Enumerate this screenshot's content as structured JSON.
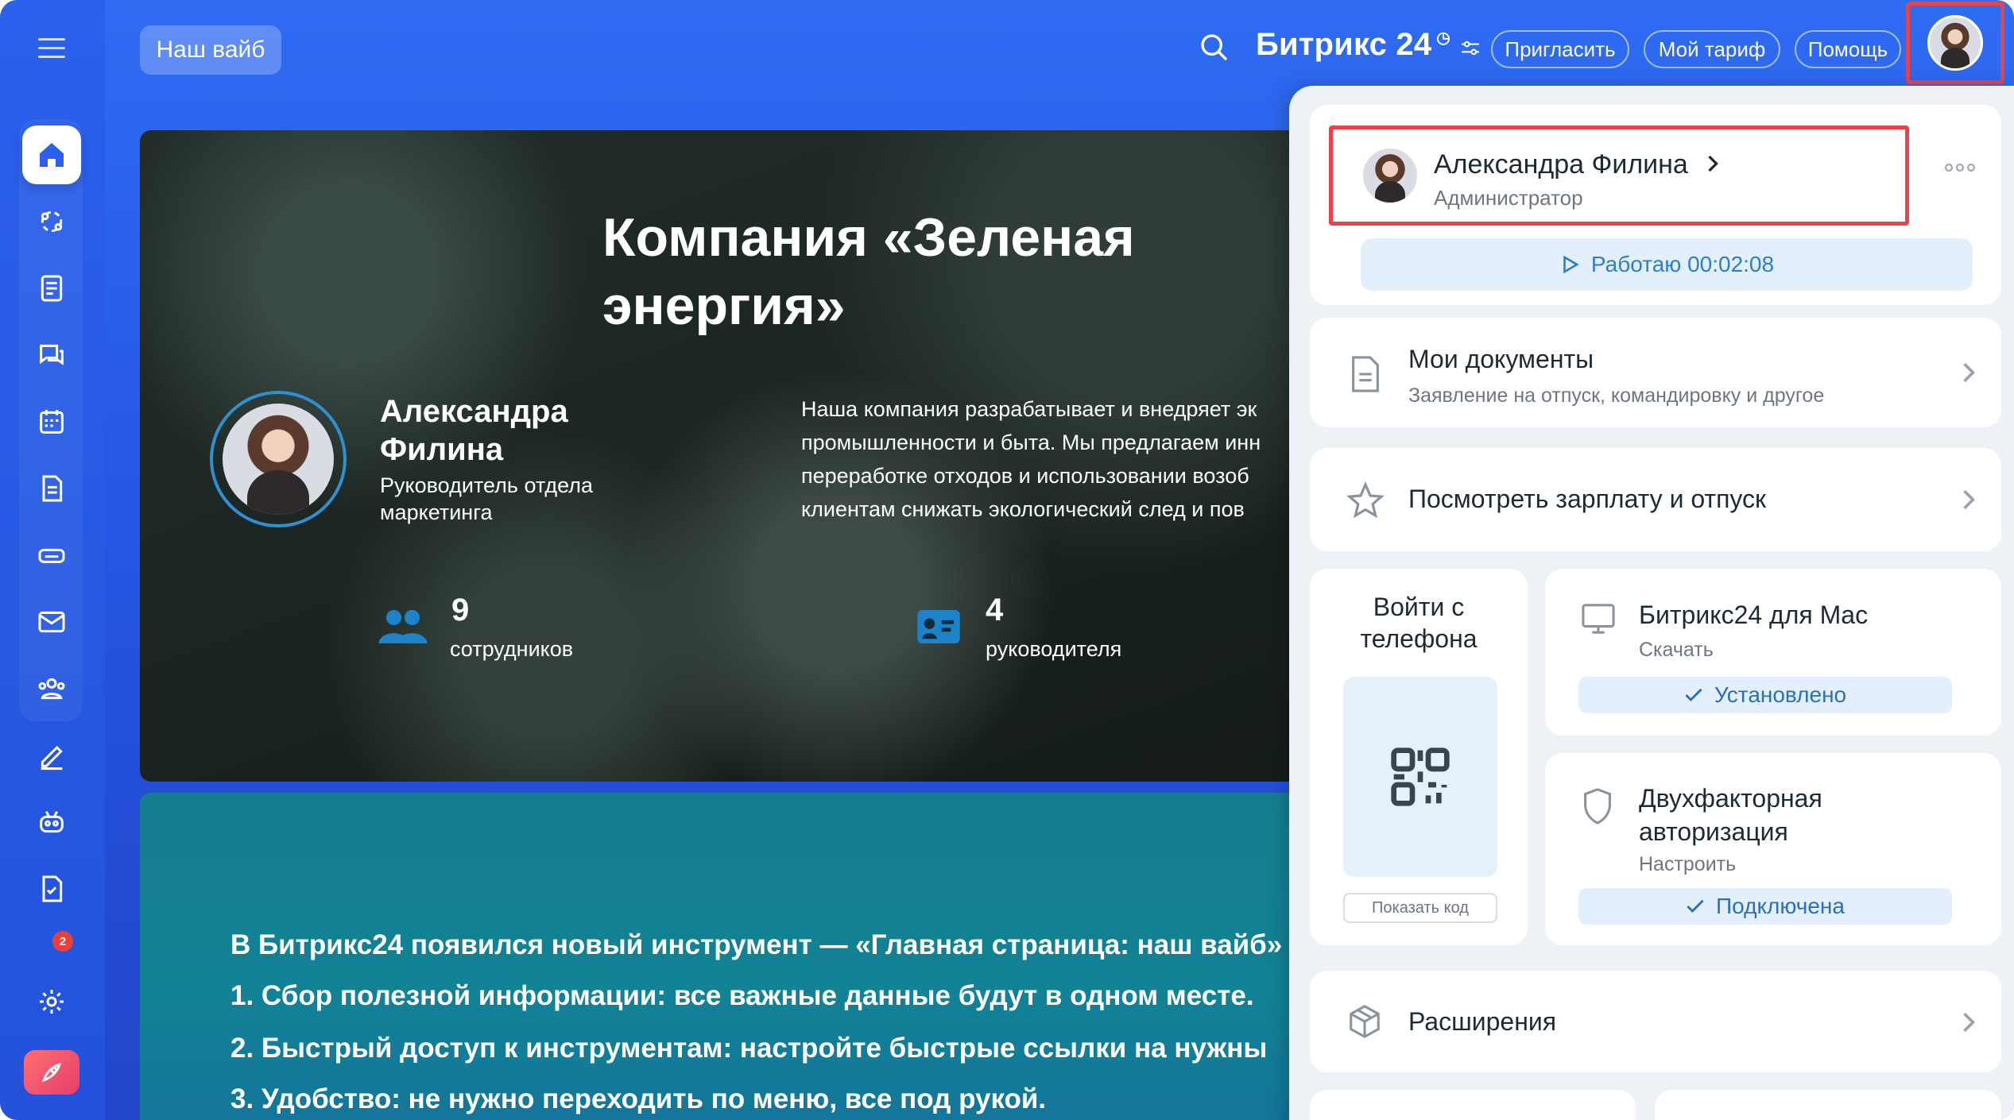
{
  "topbar": {
    "vibe_label": "Наш вайб",
    "brand": "Битрикс 24",
    "buttons": [
      "Пригласить",
      "Мой тариф",
      "Помощь"
    ]
  },
  "sidebar": {
    "items": [
      "home-icon",
      "crm-icon",
      "feed-icon",
      "chat-icon",
      "calendar-icon",
      "docs-icon",
      "drive-icon",
      "mail-icon",
      "employees-icon",
      "sign-icon",
      "bot-icon",
      "tasks-icon"
    ],
    "badge_count": "2"
  },
  "hero": {
    "title_line1": "Компания «Зеленая",
    "title_line2": "энергия»",
    "person_name_line1": "Александра",
    "person_name_line2": "Филина",
    "person_role_line1": "Руководитель отдела",
    "person_role_line2": "маркетинга",
    "description": [
      "Наша компания разрабатывает и внедряет эк",
      "промышленности и быта. Мы предлагаем инн",
      "переработке отходов и использовании возоб",
      "клиентам снижать экологический след и пов"
    ],
    "stats": [
      {
        "value": "9",
        "label": "сотрудников"
      },
      {
        "value": "4",
        "label": "руководителя"
      }
    ]
  },
  "news": {
    "lines": [
      "В Битрикс24 появился новый инструмент — «Главная страница: наш вайб»",
      "1. Сбор полезной информации: все важные данные будут в одном месте.",
      "2. Быстрый доступ к инструментам: настройте быстрые ссылки на нужны",
      "3. Удобство: не нужно переходить по меню, все под рукой."
    ]
  },
  "panel": {
    "user_name": "Александра Филина",
    "user_role": "Администратор",
    "work_status": "Работаю 00:02:08",
    "my_docs_title": "Мои документы",
    "my_docs_sub": "Заявление на отпуск, командировку и другое",
    "salary_title": "Посмотреть зарплату и отпуск",
    "phone_login_line1": "Войти с",
    "phone_login_line2": "телефона",
    "show_code": "Показать код",
    "mac_title": "Битрикс24 для Mac",
    "mac_sub": "Скачать",
    "mac_status": "Установлено",
    "twofa_title_line1": "Двухфакторная",
    "twofa_title_line2": "авторизация",
    "twofa_sub": "Настроить",
    "twofa_status": "Подключена",
    "extensions_title": "Расширения"
  },
  "colors": {
    "accent_blue": "#2c7ecf",
    "highlight_red": "#e9434a",
    "background_blue": "#2658e6"
  }
}
